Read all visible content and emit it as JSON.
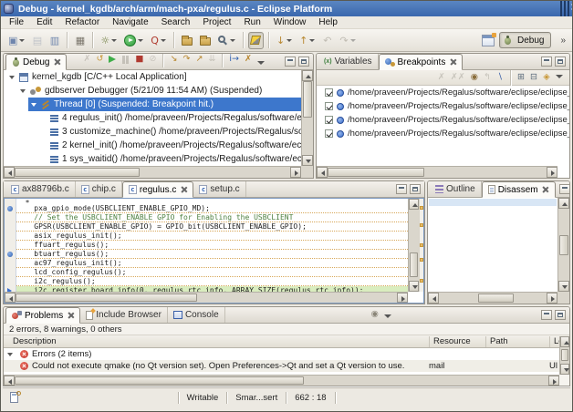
{
  "colors": {
    "titlebar": "#3a67ad",
    "selection": "#3d77cc",
    "comment_green": "#4e8040",
    "current_line_green": "#d9edbf",
    "underline_amber": "#d8a85a",
    "error_red": "#c43c35",
    "breakpoint_blue": "#2f5fae",
    "overview_marker_amber": "#e8bc6a",
    "active_editor_border": "#7d99c0"
  },
  "window": {
    "title": "Debug - kernel_kgdb/arch/arm/mach-pxa/regulus.c - Eclipse Platform",
    "controls": [
      "minimize-button",
      "maximize-button",
      "close-button"
    ]
  },
  "menu": [
    "File",
    "Edit",
    "Refactor",
    "Navigate",
    "Search",
    "Project",
    "Run",
    "Window",
    "Help"
  ],
  "main_toolbar": [
    {
      "name": "new-wizard-button",
      "glyph": "▣",
      "color": "#6f86ad",
      "dropdown": true
    },
    {
      "name": "save-button",
      "glyph": "▤",
      "color": "#8a94a8",
      "disabled": true
    },
    {
      "name": "print-button",
      "glyph": "▥",
      "color": "#6f86ad"
    },
    {
      "separator": true
    },
    {
      "name": "build-all-button",
      "glyph": "▦",
      "color": "#7a756b"
    },
    {
      "separator": true
    },
    {
      "name": "debug-dropdown-button",
      "glyph": "☼",
      "color": "#6b7a3a",
      "dropdown": true
    },
    {
      "name": "run-dropdown-button",
      "shape": "run",
      "dropdown": true
    },
    {
      "name": "external-tools-button",
      "glyph": "Q",
      "color": "#b03a2e",
      "dropdown": true
    },
    {
      "separator": true
    },
    {
      "name": "open-type-button",
      "shape": "folder"
    },
    {
      "name": "open-resource-button",
      "shape": "folder"
    },
    {
      "name": "search-button",
      "shape": "magnifier",
      "dropdown": true
    },
    {
      "separator": true
    },
    {
      "name": "mark-occurrences-toggle",
      "shape": "highlighter",
      "pressed": true
    },
    {
      "separator": true
    },
    {
      "name": "next-annotation-button",
      "glyph": "↓",
      "color": "#b8872f",
      "dropdown": true
    },
    {
      "name": "previous-annotation-button",
      "glyph": "↑",
      "color": "#b8872f",
      "dropdown": true
    },
    {
      "name": "back-button",
      "glyph": "↶",
      "color": "#8a8578",
      "disabled": true
    },
    {
      "name": "forward-button",
      "glyph": "↷",
      "color": "#8a8578",
      "disabled": true,
      "dropdown": true
    }
  ],
  "perspective_bar": {
    "debug_label": "Debug",
    "overflow_chevron": "»"
  },
  "debug_view": {
    "tabs": [
      {
        "label": "Debug",
        "icon": "debug-view-icon",
        "active": true,
        "closable": true
      }
    ],
    "toolbar": [
      {
        "name": "remove-all-terminated-button",
        "glyph": "✗",
        "color": "#9a968c",
        "disabled": true
      },
      {
        "name": "restart-button",
        "glyph": "↺",
        "color": "#c89838"
      },
      {
        "name": "resume-button",
        "shape": "play"
      },
      {
        "name": "suspend-button",
        "shape": "pause",
        "disabled": true
      },
      {
        "name": "terminate-button",
        "glyph": "■",
        "color": "#b03a30"
      },
      {
        "name": "disconnect-button",
        "glyph": "⊘",
        "color": "#9a968c",
        "disabled": true
      },
      {
        "separator": true
      },
      {
        "name": "step-into-button",
        "glyph": "↘",
        "color": "#b8872f"
      },
      {
        "name": "step-over-button",
        "glyph": "↷",
        "color": "#b8872f"
      },
      {
        "name": "step-return-button",
        "glyph": "↗",
        "color": "#b8872f"
      },
      {
        "name": "drop-to-frame-button",
        "glyph": "⇊",
        "color": "#9a968c",
        "disabled": true
      },
      {
        "separator": true
      },
      {
        "name": "instruction-stepping-button",
        "glyph": "i→",
        "color": "#2a5db0"
      },
      {
        "name": "use-step-filters-button",
        "glyph": "✗",
        "color": "#b8872f"
      }
    ],
    "tree": [
      {
        "level": 0,
        "expander": true,
        "icon": "c-application-icon",
        "label": "kernel_kgdb [C/C++ Local Application]"
      },
      {
        "level": 1,
        "expander": true,
        "icon": "debugger-icon",
        "label": "gdbserver Debugger (5/21/09 11:54 AM) (Suspended)"
      },
      {
        "level": 2,
        "expander": true,
        "icon": "thread-icon",
        "label": "Thread [0] (Suspended: Breakpoint hit.)",
        "selected": true
      },
      {
        "level": 3,
        "icon": "stack-frame-icon",
        "label": "4 regulus_init() /home/praveen/Projects/Regalus/software/eclipse/"
      },
      {
        "level": 3,
        "icon": "stack-frame-icon",
        "label": "3 customize_machine() /home/praveen/Projects/Regalus/software"
      },
      {
        "level": 3,
        "icon": "stack-frame-icon",
        "label": "2 kernel_init() /home/praveen/Projects/Regalus/software/eclipse/e"
      },
      {
        "level": 3,
        "icon": "stack-frame-icon",
        "label": "1 sys_waitid() /home/praveen/Projects/Regalus/software/eclipse/e"
      },
      {
        "level": 3,
        "icon": "stack-frame-icon",
        "label": ""
      }
    ]
  },
  "variables_breakpoints_view": {
    "tabs": [
      {
        "label": "Variables",
        "icon": "variables-icon",
        "glyph": "(x)"
      },
      {
        "label": "Breakpoints",
        "icon": "breakpoints-icon",
        "active": true,
        "closable": true
      }
    ],
    "toolbar": [
      {
        "name": "remove-selected-breakpoints-button",
        "glyph": "✗",
        "color": "#9a968c",
        "disabled": true
      },
      {
        "name": "remove-all-breakpoints-button",
        "glyph": "✗✗",
        "color": "#9a968c",
        "disabled": true
      },
      {
        "name": "show-breakpoints-for-target-button",
        "glyph": "◉",
        "color": "#8a6d3b"
      },
      {
        "name": "go-to-file-for-breakpoint-button",
        "glyph": "↰",
        "color": "#9a968c",
        "disabled": true
      },
      {
        "name": "skip-all-breakpoints-button",
        "glyph": "∖",
        "color": "#3a5fa8"
      },
      {
        "separator": true
      },
      {
        "name": "expand-all-button",
        "glyph": "⊞",
        "color": "#5b6b7b"
      },
      {
        "name": "collapse-all-button",
        "glyph": "⊟",
        "color": "#5b6b7b"
      },
      {
        "name": "link-with-debug-view-button",
        "glyph": "◈",
        "color": "#c89838"
      }
    ],
    "breakpoints": [
      {
        "checked": true,
        "label": "/home/praveen/Projects/Regalus/software/eclipse/eclipse_"
      },
      {
        "checked": true,
        "label": "/home/praveen/Projects/Regalus/software/eclipse/eclipse_"
      },
      {
        "checked": true,
        "label": "/home/praveen/Projects/Regalus/software/eclipse/eclipse_"
      },
      {
        "checked": true,
        "label": "/home/praveen/Projects/Regalus/software/eclipse/eclipse_"
      }
    ]
  },
  "editor": {
    "tabs": [
      {
        "label": "ax88796b.c",
        "icon": "c-file-icon",
        "glyph": "c"
      },
      {
        "label": "chip.c",
        "icon": "c-file-icon",
        "glyph": "c"
      },
      {
        "label": "regulus.c",
        "icon": "c-file-icon",
        "glyph": "c",
        "active": true,
        "closable": true
      },
      {
        "label": "setup.c",
        "icon": "c-file-icon",
        "glyph": "c"
      }
    ],
    "code_lines": [
      {
        "text": "  *",
        "partial": true
      },
      {
        "text": "    pxa_gpio_mode(USBCLIENT_ENABLE_GPIO_MD);",
        "type": "code",
        "breakpoint": true
      },
      {
        "text": "    // Set the USBCLIENT_ENABLE GPIO for Enabling the USBCLIENT",
        "type": "comment"
      },
      {
        "text": "    GPSR(USBCLIENT_ENABLE_GPIO) = GPIO_bit(USBCLIENT_ENABLE_GPIO);",
        "type": "code"
      },
      {
        "text": "    asix_regulus_init();",
        "type": "code"
      },
      {
        "text": "    ffuart_regulus();",
        "type": "code"
      },
      {
        "text": "    btuart_regulus();",
        "type": "code",
        "breakpoint": true
      },
      {
        "text": "    ac97_regulus_init();",
        "type": "code"
      },
      {
        "text": "    lcd_config_regulus();",
        "type": "code"
      },
      {
        "text": "    i2c_regulus();",
        "type": "code"
      },
      {
        "text": "    i2c_register_board_info(0, regulus_rtc_info, ARRAY_SIZE(regulus_rtc_info));",
        "type": "code",
        "current": true
      }
    ],
    "overview_markers": [
      8,
      26,
      48,
      64,
      86
    ]
  },
  "outline_view": {
    "tabs": [
      {
        "label": "Outline",
        "icon": "outline-icon"
      },
      {
        "label": "Disassem",
        "icon": "disassembly-icon",
        "active": true,
        "closable": true
      }
    ]
  },
  "problems_view": {
    "tabs": [
      {
        "label": "Problems",
        "icon": "problems-icon",
        "active": true,
        "closable": true
      },
      {
        "label": "Include Browser",
        "icon": "include-browser-icon"
      },
      {
        "label": "Console",
        "icon": "console-icon"
      }
    ],
    "toolbar": [
      {
        "name": "filter-button",
        "glyph": "◉",
        "color": "#8a8578"
      }
    ],
    "summary": "2 errors, 8 warnings, 0 others",
    "columns": [
      "Description",
      "Resource",
      "Path",
      "Lo"
    ],
    "rows": [
      {
        "kind": "group",
        "label": "Errors (2 items)"
      },
      {
        "kind": "error",
        "description": "Could not execute qmake (no Qt version set). Open Preferences->Qt and set a Qt version to use.",
        "resource": "mail",
        "path": "",
        "location": "Ul"
      }
    ]
  },
  "status_bar": {
    "writable_label": "Writable",
    "input_mode_label": "Smar...sert",
    "caret_position": "662 : 18"
  }
}
